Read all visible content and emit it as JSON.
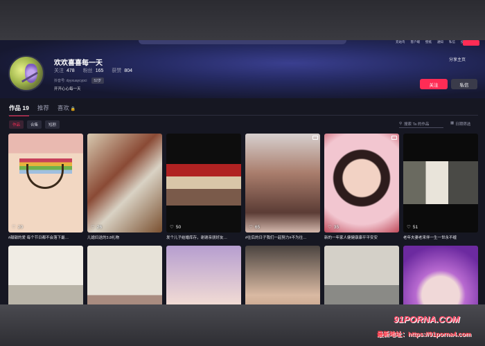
{
  "nav": {
    "links": [
      "充站鸟",
      "客户端",
      "壁纸",
      "通知",
      "私信",
      "投稿"
    ]
  },
  "profile": {
    "name": "欢欢喜喜每一天",
    "stats": [
      {
        "label": "关注",
        "value": "478"
      },
      {
        "label": "粉丝",
        "value": "165"
      },
      {
        "label": "获赞",
        "value": "804"
      }
    ],
    "account_id": "抖音号: dyyxuaycypci",
    "age": "52岁",
    "bio": "开开心心每一天",
    "share_label": "分享主页",
    "follow_label": "关注",
    "message_label": "私信"
  },
  "tabs": [
    {
      "label": "作品 19",
      "active": true
    },
    {
      "label": "推荐",
      "active": false
    },
    {
      "label": "喜欢",
      "active": false,
      "locked": true
    }
  ],
  "filters": [
    {
      "label": "作品",
      "active": true
    },
    {
      "label": "合集",
      "active": false
    },
    {
      "label": "短剧",
      "active": false
    }
  ],
  "search": {
    "placeholder": "搜索 Ta 的作品"
  },
  "sort_label": "日期筛选",
  "videos": [
    {
      "likes": "20",
      "caption": "#甜甜的爱 每个节日都不会落下最…",
      "pinned": false
    },
    {
      "likes": "26",
      "caption": "儿媳妇送的3.8礼物",
      "pinned": false
    },
    {
      "likes": "50",
      "caption": "发个儿子结婚库存，谢谢亲朋好友…",
      "pinned": false
    },
    {
      "likes": "65",
      "caption": "#往后的日子我们一起努力#不为往…",
      "pinned": true
    },
    {
      "likes": "35",
      "caption": "新的一年家人健健康康平平安安",
      "pinned": true
    },
    {
      "likes": "51",
      "caption": "老年夫妻老来伴一生一世永不缠",
      "pinned": false
    },
    {
      "likes": "",
      "caption": "",
      "pinned": false
    },
    {
      "likes": "",
      "caption": "",
      "pinned": false
    },
    {
      "likes": "",
      "caption": "",
      "pinned": false
    },
    {
      "likes": "",
      "caption": "",
      "pinned": false
    },
    {
      "likes": "",
      "caption": "",
      "pinned": false
    },
    {
      "likes": "",
      "caption": "",
      "pinned": false
    }
  ],
  "watermark": {
    "logo": "91PORNA.COM",
    "url_text": "最新地址：https://91porna4.com"
  }
}
